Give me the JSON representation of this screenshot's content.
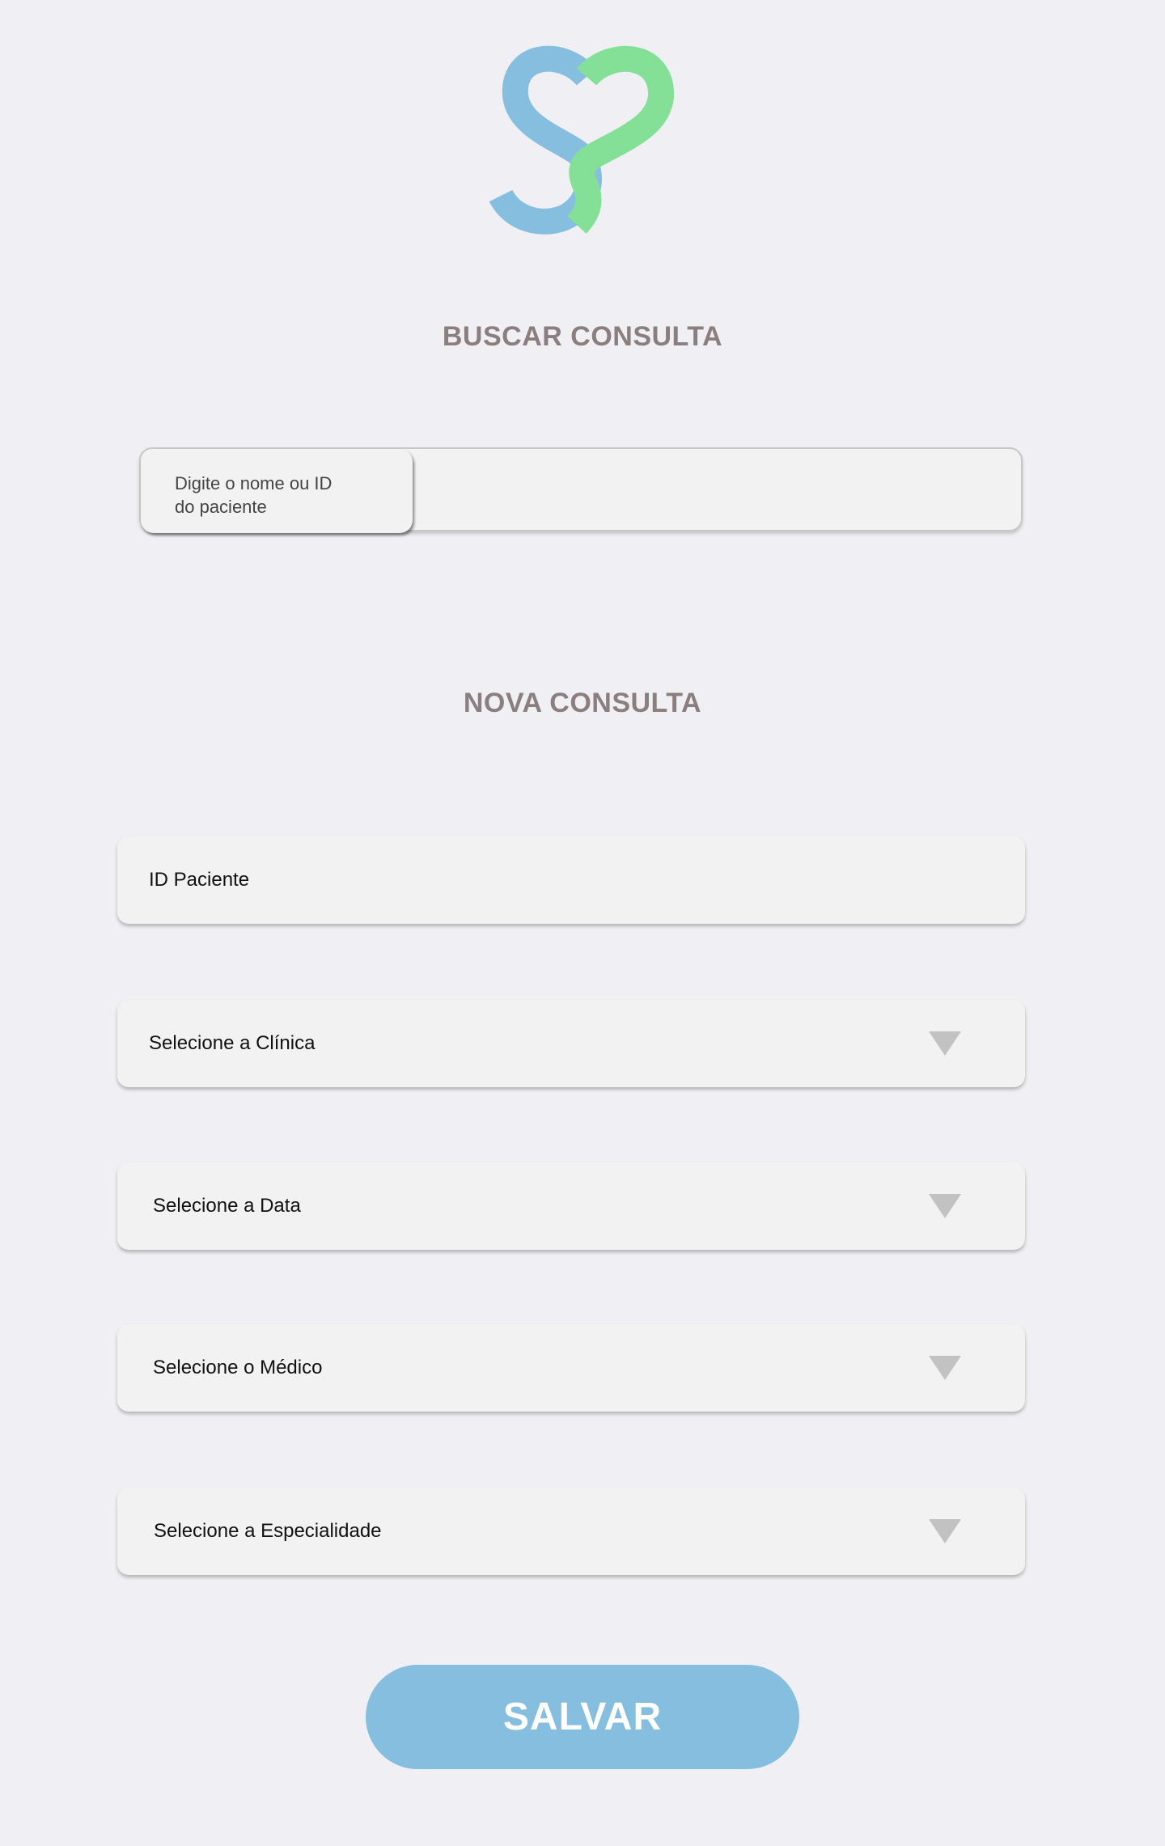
{
  "logo": {
    "icon": "heart-s-logo",
    "colors": {
      "blue": "#86bedf",
      "green": "#84e096"
    }
  },
  "search_section": {
    "title": "BUSCAR CONSULTA",
    "placeholder_line1": "Digite o nome ou ID",
    "placeholder_line2": "do paciente"
  },
  "new_section": {
    "title": "NOVA CONSULTA",
    "fields": [
      {
        "label": "ID Paciente",
        "type": "input"
      },
      {
        "label": "Selecione a Clínica",
        "type": "select",
        "icon": "chevron-down-icon"
      },
      {
        "label": "Selecione a Data",
        "type": "select",
        "icon": "chevron-down-icon"
      },
      {
        "label": "Selecione o Médico",
        "type": "select",
        "icon": "chevron-down-icon"
      },
      {
        "label": "Selecione a Especialidade",
        "type": "select",
        "icon": "chevron-down-icon"
      }
    ]
  },
  "save_button": {
    "label": "SALVAR",
    "color": "#86bedf"
  }
}
